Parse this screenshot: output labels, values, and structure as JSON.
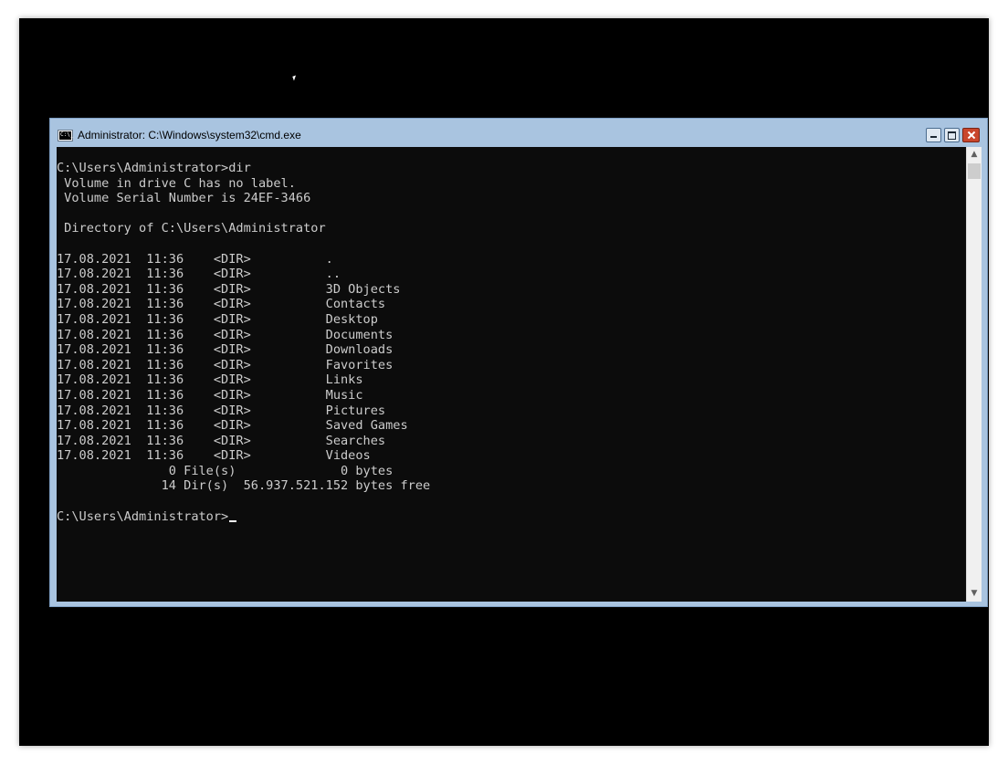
{
  "window": {
    "title": "Administrator: C:\\Windows\\system32\\cmd.exe",
    "icon": "cmd-icon",
    "controls": [
      "minimize-icon",
      "maximize-icon",
      "close-icon"
    ]
  },
  "console": {
    "lines": [
      "C:\\Users\\Administrator>dir",
      " Volume in drive C has no label.",
      " Volume Serial Number is 24EF-3466",
      "",
      " Directory of C:\\Users\\Administrator",
      "",
      "17.08.2021  11:36    <DIR>          .",
      "17.08.2021  11:36    <DIR>          ..",
      "17.08.2021  11:36    <DIR>          3D Objects",
      "17.08.2021  11:36    <DIR>          Contacts",
      "17.08.2021  11:36    <DIR>          Desktop",
      "17.08.2021  11:36    <DIR>          Documents",
      "17.08.2021  11:36    <DIR>          Downloads",
      "17.08.2021  11:36    <DIR>          Favorites",
      "17.08.2021  11:36    <DIR>          Links",
      "17.08.2021  11:36    <DIR>          Music",
      "17.08.2021  11:36    <DIR>          Pictures",
      "17.08.2021  11:36    <DIR>          Saved Games",
      "17.08.2021  11:36    <DIR>          Searches",
      "17.08.2021  11:36    <DIR>          Videos",
      "               0 File(s)              0 bytes",
      "              14 Dir(s)  56.937.521.152 bytes free",
      ""
    ],
    "prompt": "C:\\Users\\Administrator>"
  },
  "colors": {
    "console_bg": "#0c0c0c",
    "console_fg": "#cccccc",
    "frame": "#a9c4e0",
    "close_button": "#c9462c"
  }
}
